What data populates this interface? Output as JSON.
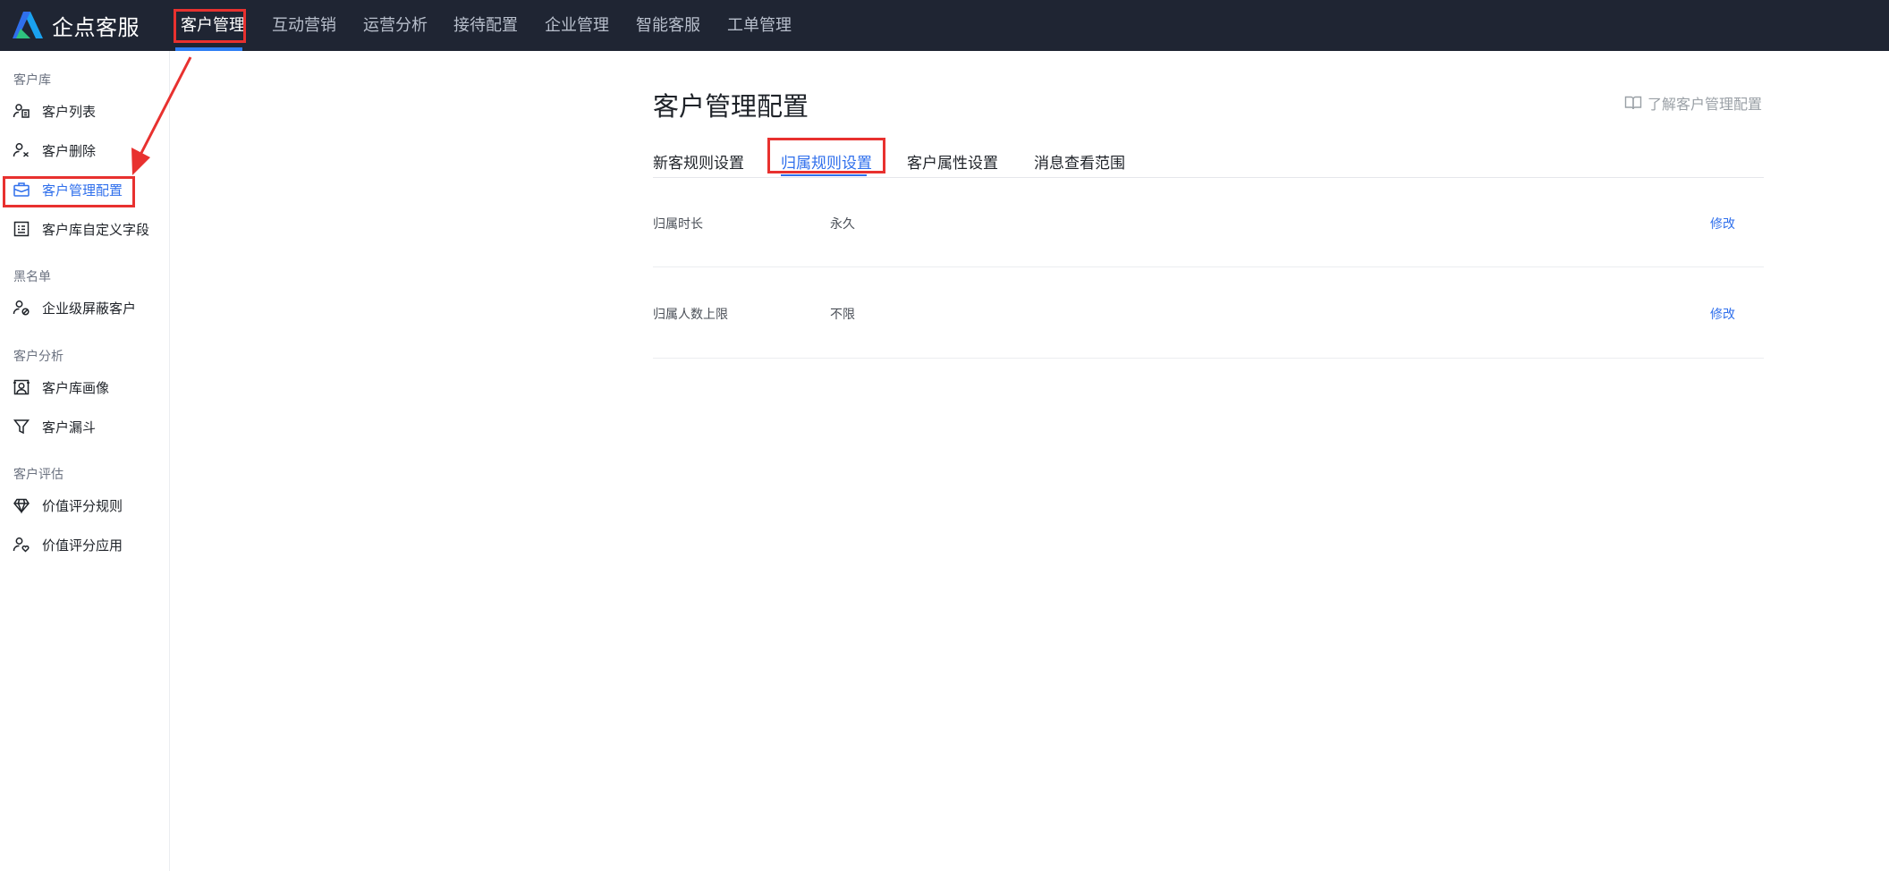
{
  "app": {
    "name": "企点客服"
  },
  "topnav": {
    "items": [
      {
        "label": "客户管理",
        "active": true
      },
      {
        "label": "互动营销"
      },
      {
        "label": "运营分析"
      },
      {
        "label": "接待配置"
      },
      {
        "label": "企业管理"
      },
      {
        "label": "智能客服"
      },
      {
        "label": "工单管理"
      }
    ]
  },
  "sidebar": {
    "groups": [
      {
        "title": "客户库",
        "items": [
          {
            "label": "客户列表",
            "icon": "customer-list-icon"
          },
          {
            "label": "客户删除",
            "icon": "user-remove-icon"
          },
          {
            "label": "客户管理配置",
            "icon": "briefcase-icon",
            "active": true
          },
          {
            "label": "客户库自定义字段",
            "icon": "form-fields-icon"
          }
        ]
      },
      {
        "title": "黑名单",
        "items": [
          {
            "label": "企业级屏蔽客户",
            "icon": "user-block-icon"
          }
        ]
      },
      {
        "title": "客户分析",
        "items": [
          {
            "label": "客户库画像",
            "icon": "portrait-icon"
          },
          {
            "label": "客户漏斗",
            "icon": "funnel-icon"
          }
        ]
      },
      {
        "title": "客户评估",
        "items": [
          {
            "label": "价值评分规则",
            "icon": "diamond-icon"
          },
          {
            "label": "价值评分应用",
            "icon": "user-heart-icon"
          }
        ]
      }
    ]
  },
  "main": {
    "title": "客户管理配置",
    "help_link": "了解客户管理配置",
    "tabs": [
      {
        "label": "新客规则设置"
      },
      {
        "label": "归属规则设置",
        "active": true
      },
      {
        "label": "客户属性设置"
      },
      {
        "label": "消息查看范围"
      }
    ],
    "rows": [
      {
        "label": "归属时长",
        "value": "永久",
        "action": "修改"
      },
      {
        "label": "归属人数上限",
        "value": "不限",
        "action": "修改"
      }
    ]
  },
  "colors": {
    "topbar_bg": "#1f2533",
    "accent": "#2f6fec",
    "annotation_red": "#e8312f"
  }
}
